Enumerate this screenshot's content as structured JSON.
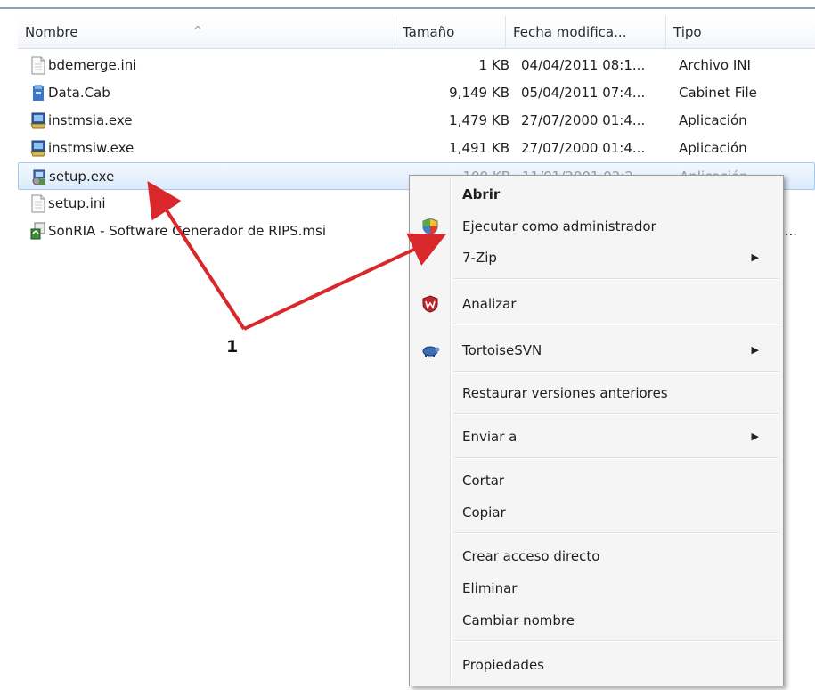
{
  "columns": {
    "name": "Nombre",
    "size": "Tamaño",
    "date": "Fecha modifica...",
    "type": "Tipo"
  },
  "files": [
    {
      "name": "bdemerge.ini",
      "size": "1 KB",
      "date": "04/04/2011 08:1...",
      "type": "Archivo INI",
      "icon": "ini-file-icon"
    },
    {
      "name": "Data.Cab",
      "size": "9,149 KB",
      "date": "05/04/2011 07:4...",
      "type": "Cabinet File",
      "icon": "cabinet-file-icon"
    },
    {
      "name": "instmsia.exe",
      "size": "1,479 KB",
      "date": "27/07/2000 01:4...",
      "type": "Aplicación",
      "icon": "installer-exe-icon"
    },
    {
      "name": "instmsiw.exe",
      "size": "1,491 KB",
      "date": "27/07/2000 01:4...",
      "type": "Aplicación",
      "icon": "installer-exe-icon"
    },
    {
      "name": "setup.exe",
      "size": "100 KB",
      "date": "11/01/2001 02:2...",
      "type": "Aplicación",
      "icon": "setup-exe-icon"
    },
    {
      "name": "setup.ini",
      "size": "",
      "date": "",
      "type": "",
      "icon": "ini-file-icon"
    },
    {
      "name": "SonRIA - Software Generador de RIPS.msi",
      "size": "",
      "date": "",
      "type": "Wi...",
      "icon": "msi-package-icon"
    }
  ],
  "context_menu": {
    "items": [
      {
        "label": "Abrir",
        "bold": true
      },
      {
        "label": "Ejecutar como administrador",
        "icon": "uac-shield-icon"
      },
      {
        "label": "7-Zip",
        "submenu": true
      },
      {
        "label": "Analizar",
        "icon": "mcafee-shield-icon"
      },
      {
        "label": "TortoiseSVN",
        "icon": "tortoisesvn-icon",
        "submenu": true
      },
      {
        "label": "Restaurar versiones anteriores"
      },
      {
        "label": "Enviar a",
        "submenu": true
      },
      {
        "label": "Cortar"
      },
      {
        "label": "Copiar"
      },
      {
        "label": "Crear acceso directo"
      },
      {
        "label": "Eliminar"
      },
      {
        "label": "Cambiar nombre"
      },
      {
        "label": "Propiedades"
      }
    ]
  },
  "annotation": {
    "label": "1",
    "color": "#d9282b"
  },
  "colors": {
    "selection": "#dcebfc",
    "menu_bg": "#f5f5f5",
    "arrow": "#d9282b"
  }
}
